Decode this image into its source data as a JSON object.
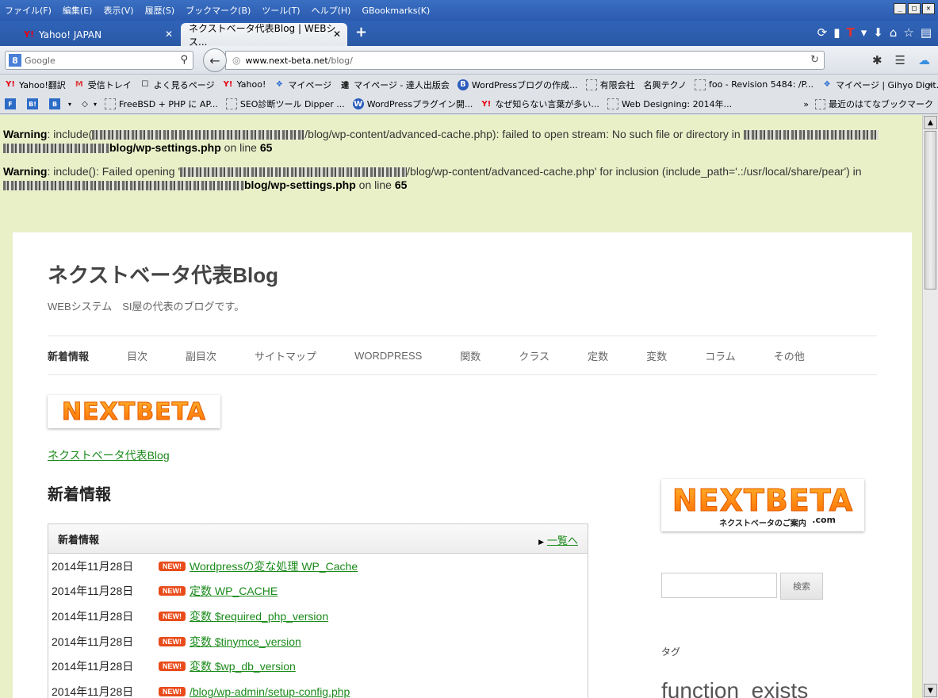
{
  "menubar": {
    "items": [
      "ファイル(F)",
      "編集(E)",
      "表示(V)",
      "履歴(S)",
      "ブックマーク(B)",
      "ツール(T)",
      "ヘルプ(H)",
      "GBookmarks(K)"
    ]
  },
  "tabs": [
    {
      "label": "Yahoo! JAPAN",
      "favicon": "Y!"
    },
    {
      "label": "ネクストベータ代表Blog | WEBシス..."
    }
  ],
  "search": {
    "placeholder": "Google",
    "engine_icon": "8"
  },
  "url": {
    "host": "www.next-beta.net",
    "path": "/blog/"
  },
  "bookmarks_row1": [
    {
      "icon": "Y!",
      "label": "Yahoo!翻訳"
    },
    {
      "icon": "M",
      "label": "受信トレイ"
    },
    {
      "icon": "☐",
      "label": "よく見るページ"
    },
    {
      "icon": "Y!",
      "label": "Yahoo!"
    },
    {
      "icon": "❖",
      "label": "マイページ"
    },
    {
      "icon": "達",
      "label": "マイページ - 達人出版会"
    },
    {
      "icon": "B",
      "label": "WordPressブログの作成..."
    },
    {
      "icon": "☐",
      "label": "有限会社　名興テクノ"
    },
    {
      "icon": "☐",
      "label": "foo - Revision 5484: /P..."
    },
    {
      "icon": "❖",
      "label": "マイページ | Gihyo Digit..."
    }
  ],
  "bookmarks_row2": [
    {
      "icon": "F",
      "label": ""
    },
    {
      "icon": "B!",
      "label": ""
    },
    {
      "icon": "B",
      "label": ""
    },
    {
      "icon": "◇",
      "label": ""
    },
    {
      "icon": "☐",
      "label": "FreeBSD + PHP に AP..."
    },
    {
      "icon": "☐",
      "label": "SEO診断ツール Dipper ..."
    },
    {
      "icon": "W",
      "label": "WordPressプラグイン開..."
    },
    {
      "icon": "Y!",
      "label": "なぜ知らない言葉が多い..."
    },
    {
      "icon": "☐",
      "label": "Web Designing: 2014年..."
    }
  ],
  "bookmarks_more": "»",
  "bookmarks_recent": "最近のはてなブックマーク",
  "warnings": [
    {
      "label": "Warning",
      "text1": ": include(",
      "text2": "/blog/wp-content/advanced-cache.php): failed to open stream: No such file or directory in ",
      "file": "blog/wp-settings.php",
      "online": " on line ",
      "line": "65"
    },
    {
      "label": "Warning",
      "text1": ": include(): Failed opening '",
      "text2": "/blog/wp-content/advanced-cache.php' for inclusion (include_path='.:/usr/local/share/pear') in ",
      "file": "blog/wp-settings.php",
      "online": " on line ",
      "line": "65"
    }
  ],
  "site": {
    "title": "ネクストベータ代表Blog",
    "description": "WEBシステム　SI屋の代表のブログです。",
    "nav": [
      "新着情報",
      "目次",
      "副目次",
      "サイトマップ",
      "WORDPRESS",
      "関数",
      "クラス",
      "定数",
      "変数",
      "コラム",
      "その他"
    ],
    "logo_text": "NEXTBETA",
    "breadcrumb": "ネクストベータ代表Blog",
    "section_title": "新着情報"
  },
  "news": {
    "header": "新着情報",
    "more_label": "一覧へ",
    "new_badge": "NEW!",
    "rows": [
      {
        "date": "2014年11月28日",
        "title": "Wordpressの変な処理 WP_Cache"
      },
      {
        "date": "2014年11月28日",
        "title": "定数  WP_CACHE"
      },
      {
        "date": "2014年11月28日",
        "title": "変数  $required_php_version"
      },
      {
        "date": "2014年11月28日",
        "title": "変数  $tinymce_version"
      },
      {
        "date": "2014年11月28日",
        "title": "変数  $wp_db_version"
      },
      {
        "date": "2014年11月28日",
        "title": "/blog/wp-admin/setup-config.php"
      }
    ]
  },
  "sidebar": {
    "logo_text": "NEXTBETA",
    "logo_sub": "ネクストベータのご案内",
    "logo_dotcom": ".com",
    "search_button": "検索",
    "tag_label": "タグ",
    "tag_big": "function_exists"
  }
}
